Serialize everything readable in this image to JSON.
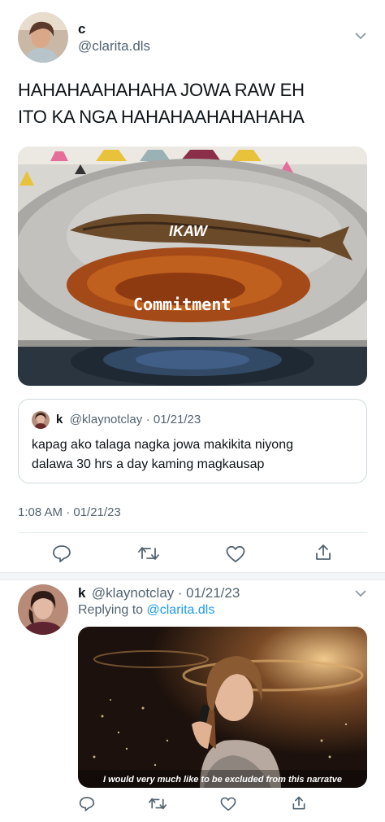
{
  "main_tweet": {
    "display_name": "c",
    "handle": "@clarita.dls",
    "text_line1": "HAHAHAAHAHAHA JOWA RAW EH",
    "text_line2": "ITO KA NGA HAHAHAAHAHAHAHA",
    "media": {
      "label_top": "IKAW",
      "label_bottom": "Commitment"
    },
    "quote": {
      "display_name": "k",
      "handle": "@klaynotclay",
      "date": "· 01/21/23",
      "text_line1": "kapag ako talaga nagka jowa makikita niyong",
      "text_line2": "dalawa 30 hrs a day kaming magkausap"
    },
    "timestamp": "1:08 AM · 01/21/23"
  },
  "reply_tweet": {
    "display_name": "k",
    "handle": "@klaynotclay",
    "date": "· 01/21/23",
    "replying_prefix": "Replying to",
    "replying_handle": "@clarita.dls",
    "media_caption": "I would very much like to be excluded from this narratve"
  },
  "icons": [
    "chevron-down-icon",
    "reply-icon",
    "retweet-icon",
    "like-icon",
    "share-icon"
  ],
  "colors": {
    "link": "#1d9bf0",
    "secondary_text": "#536471",
    "icon": "#536471"
  }
}
